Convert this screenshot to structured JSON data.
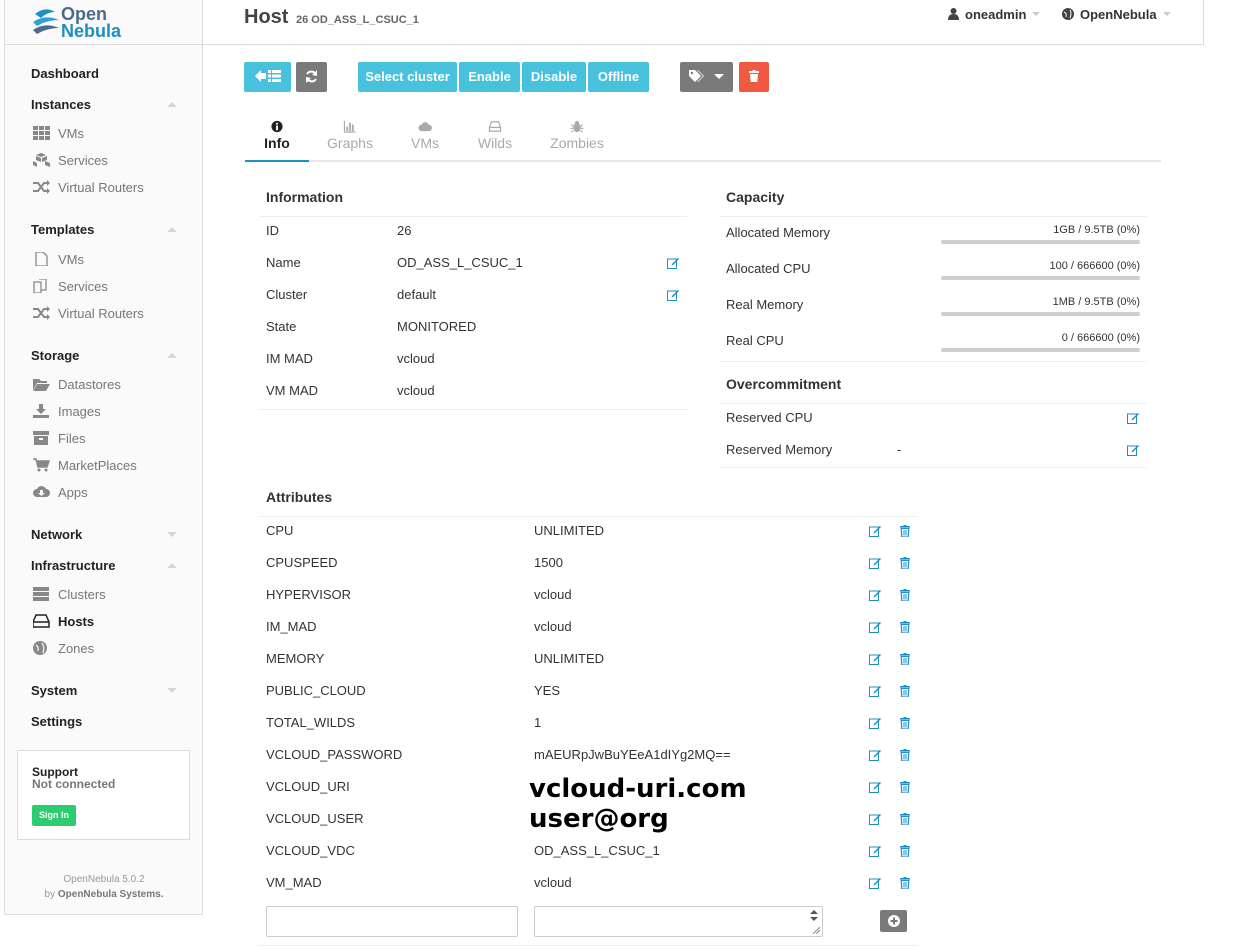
{
  "brand": {
    "line1": "Open",
    "line2": "Nebula"
  },
  "sidebar": {
    "dashboard": "Dashboard",
    "instances": {
      "label": "Instances",
      "items": [
        "VMs",
        "Services",
        "Virtual Routers"
      ]
    },
    "templates": {
      "label": "Templates",
      "items": [
        "VMs",
        "Services",
        "Virtual Routers"
      ]
    },
    "storage": {
      "label": "Storage",
      "items": [
        "Datastores",
        "Images",
        "Files",
        "MarketPlaces",
        "Apps"
      ]
    },
    "network": "Network",
    "infrastructure": {
      "label": "Infrastructure",
      "items": [
        "Clusters",
        "Hosts",
        "Zones"
      ]
    },
    "system": "System",
    "settings": "Settings",
    "support": {
      "title": "Support",
      "status": "Not connected",
      "signin": "Sign In"
    },
    "footer": {
      "version": "OpenNebula 5.0.2",
      "by": "by",
      "company": "OpenNebula Systems."
    }
  },
  "header": {
    "title": "Host",
    "subtitle": "26 OD_ASS_L_CSUC_1",
    "user": "oneadmin",
    "zone": "OpenNebula"
  },
  "actions": {
    "select_cluster": "Select cluster",
    "enable": "Enable",
    "disable": "Disable",
    "offline": "Offline"
  },
  "tabs": [
    "Info",
    "Graphs",
    "VMs",
    "Wilds",
    "Zombies"
  ],
  "information": {
    "heading": "Information",
    "rows": [
      {
        "key": "ID",
        "value": "26"
      },
      {
        "key": "Name",
        "value": "OD_ASS_L_CSUC_1"
      },
      {
        "key": "Cluster",
        "value": "default"
      },
      {
        "key": "State",
        "value": "MONITORED"
      },
      {
        "key": "IM MAD",
        "value": "vcloud"
      },
      {
        "key": "VM MAD",
        "value": "vcloud"
      }
    ]
  },
  "capacity": {
    "heading": "Capacity",
    "rows": [
      {
        "key": "Allocated Memory",
        "value": "1GB / 9.5TB (0%)",
        "fraction": 0
      },
      {
        "key": "Allocated CPU",
        "value": "100 / 666600 (0%)",
        "fraction": 0
      },
      {
        "key": "Real Memory",
        "value": "1MB / 9.5TB (0%)",
        "fraction": 0
      },
      {
        "key": "Real CPU",
        "value": "0 / 666600 (0%)",
        "fraction": 0
      }
    ]
  },
  "overcommitment": {
    "heading": "Overcommitment",
    "rows": [
      {
        "key": "Reserved CPU",
        "value": ""
      },
      {
        "key": "Reserved Memory",
        "value": "-"
      }
    ]
  },
  "attributes": {
    "heading": "Attributes",
    "rows": [
      {
        "key": "CPU",
        "value": "UNLIMITED"
      },
      {
        "key": "CPUSPEED",
        "value": "1500"
      },
      {
        "key": "HYPERVISOR",
        "value": "vcloud"
      },
      {
        "key": "IM_MAD",
        "value": "vcloud"
      },
      {
        "key": "MEMORY",
        "value": "UNLIMITED"
      },
      {
        "key": "PUBLIC_CLOUD",
        "value": "YES"
      },
      {
        "key": "TOTAL_WILDS",
        "value": "1"
      },
      {
        "key": "VCLOUD_PASSWORD",
        "value": "mAEURpJwBuYEeA1dIYg2MQ=="
      },
      {
        "key": "VCLOUD_URI",
        "value": ""
      },
      {
        "key": "VCLOUD_USER",
        "value": ""
      },
      {
        "key": "VCLOUD_VDC",
        "value": "OD_ASS_L_CSUC_1"
      },
      {
        "key": "VM_MAD",
        "value": "vcloud"
      }
    ]
  },
  "overlay": {
    "uri": "vcloud-uri.com",
    "user": "user@org"
  },
  "colors": {
    "accent": "#48c1dd",
    "danger": "#ef5a43",
    "neutral": "#7a7a7a",
    "link": "#1e8fc4",
    "success": "#2ecc71"
  }
}
